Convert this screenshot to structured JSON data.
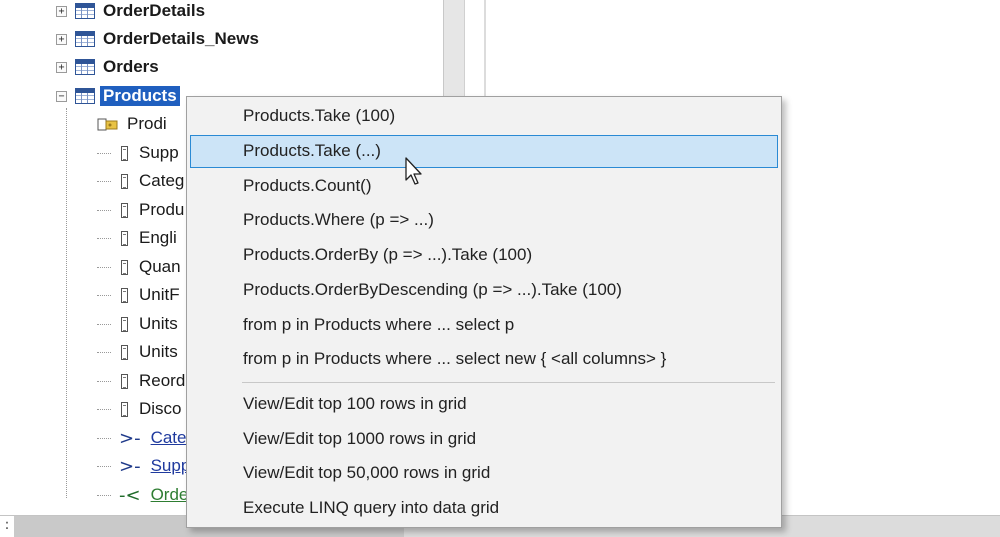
{
  "tree": {
    "tables": [
      {
        "name": "OrderDetails",
        "expander": "+",
        "selected": false
      },
      {
        "name": "OrderDetails_News",
        "expander": "+",
        "selected": false
      },
      {
        "name": "Orders",
        "expander": "+",
        "selected": false
      },
      {
        "name": "Products",
        "expander": "−",
        "selected": true
      }
    ],
    "product_children": [
      {
        "label": "Prodi",
        "kind": "key"
      },
      {
        "label": "Supp",
        "kind": "column"
      },
      {
        "label": "Categ",
        "kind": "column"
      },
      {
        "label": "Produ",
        "kind": "column"
      },
      {
        "label": "Engli",
        "kind": "column"
      },
      {
        "label": "Quan",
        "kind": "column"
      },
      {
        "label": "UnitF",
        "kind": "column"
      },
      {
        "label": "Units",
        "kind": "column"
      },
      {
        "label": "Units",
        "kind": "column"
      },
      {
        "label": "Reord",
        "kind": "column"
      },
      {
        "label": "Disco",
        "kind": "column"
      },
      {
        "label": "Categ",
        "kind": "parent-relation"
      },
      {
        "label": "Supp",
        "kind": "parent-relation"
      },
      {
        "label": "Orde",
        "kind": "child-relation"
      }
    ]
  },
  "context_menu": {
    "query_items": [
      "Products.Take (100)",
      "Products.Take (...)",
      "Products.Count()",
      "Products.Where (p => ...)",
      "Products.OrderBy (p => ...).Take (100)",
      "Products.OrderByDescending (p => ...).Take (100)",
      "from p in Products where ...  select p",
      "from p in Products where ...  select new { <all columns> }"
    ],
    "grid_items": [
      "View/Edit top 100 rows in grid",
      "View/Edit top 1000 rows in grid",
      "View/Edit top 50,000 rows in grid",
      "Execute LINQ query into data grid"
    ],
    "hovered_item": "Products.Take (...)"
  },
  "status_bar": {
    "left_text": ":"
  },
  "colors": {
    "selection": "#1f5fbf",
    "menu_hover_bg": "#cce4f7",
    "menu_hover_border": "#2a8ad4",
    "relation_link": "#1f3a9e",
    "child_relation_link": "#2e7d32"
  }
}
